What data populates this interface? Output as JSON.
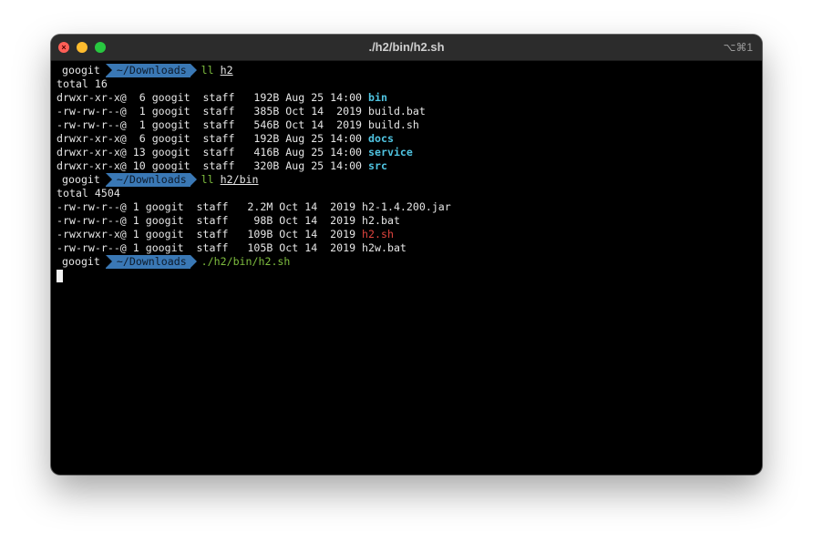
{
  "window": {
    "title": "./h2/bin/h2.sh",
    "shortcut": "⌥⌘1",
    "close_glyph": "×"
  },
  "prompt": {
    "user": "googit",
    "cwd": "~/Downloads"
  },
  "commands": [
    {
      "cmd": "ll",
      "arg": "h2"
    },
    {
      "cmd": "ll",
      "arg": "h2/bin"
    },
    {
      "cmd": "./h2/bin/h2.sh",
      "arg": ""
    }
  ],
  "listing1": {
    "total": "total 16",
    "rows": [
      {
        "prefix": "drwxr-xr-x@  6 googit  staff   192B Aug 25 14:00 ",
        "name": "bin"
      },
      {
        "prefix": "-rw-rw-r--@  1 googit  staff   385B Oct 14  2019 ",
        "name": "build.bat"
      },
      {
        "prefix": "-rw-rw-r--@  1 googit  staff   546B Oct 14  2019 ",
        "name": "build.sh"
      },
      {
        "prefix": "drwxr-xr-x@  6 googit  staff   192B Aug 25 14:00 ",
        "name": "docs"
      },
      {
        "prefix": "drwxr-xr-x@ 13 googit  staff   416B Aug 25 14:00 ",
        "name": "service"
      },
      {
        "prefix": "drwxr-xr-x@ 10 googit  staff   320B Aug 25 14:00 ",
        "name": "src"
      }
    ]
  },
  "listing2": {
    "total": "total 4504",
    "rows": [
      {
        "prefix": "-rw-rw-r--@ 1 googit  staff   2.2M Oct 14  2019 ",
        "name": "h2-1.4.200.jar"
      },
      {
        "prefix": "-rw-rw-r--@ 1 googit  staff    98B Oct 14  2019 ",
        "name": "h2.bat"
      },
      {
        "prefix": "-rwxrwxr-x@ 1 googit  staff   109B Oct 14  2019 ",
        "name": "h2.sh"
      },
      {
        "prefix": "-rw-rw-r--@ 1 googit  staff   105B Oct 14  2019 ",
        "name": "h2w.bat"
      }
    ]
  },
  "colors": {
    "directory": "#4fc3e0",
    "executable": "#e0443e",
    "command": "#7fbf3f",
    "prompt_dir_bg": "#3a78b5"
  }
}
